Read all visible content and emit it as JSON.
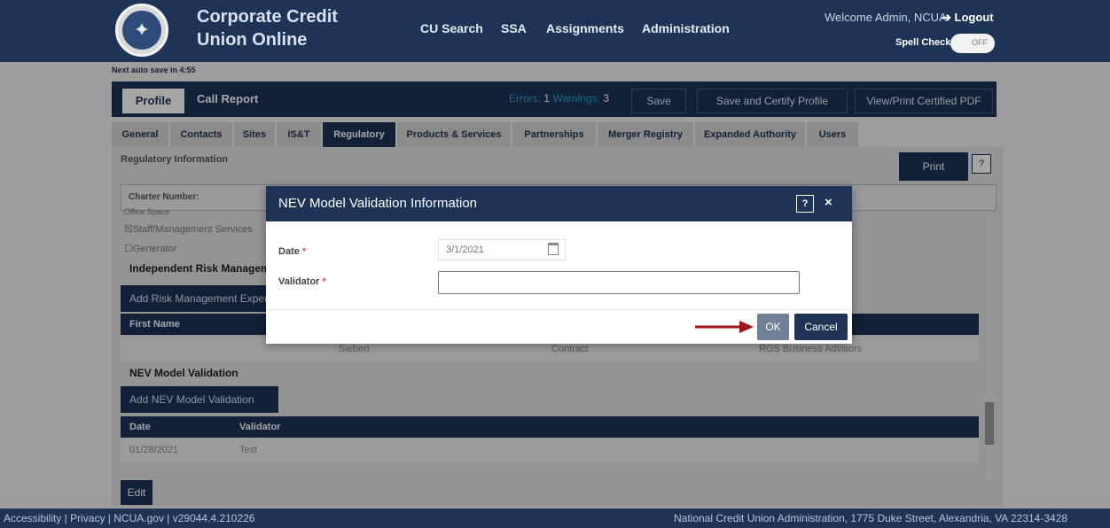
{
  "header": {
    "title_line1": "Corporate Credit",
    "title_line2": "Union Online",
    "nav": [
      "CU Search",
      "SSA",
      "Assignments",
      "Administration"
    ],
    "welcome": "Welcome Admin, NCUA",
    "logout": "Logout",
    "spell_check_label": "Spell Check",
    "spell_check_state": "OFF",
    "logo_glyph": "✦"
  },
  "autosave": "Next auto save in 4:55",
  "profile_bar": {
    "tabs": [
      "Profile",
      "Call Report"
    ],
    "errors_label": "Errors:",
    "errors_count": "1",
    "warnings_label": "Warnings:",
    "warnings_count": "3",
    "save": "Save",
    "save_certify": "Save and Certify Profile",
    "view_print": "View/Print Certified PDF"
  },
  "sub_tabs": [
    "General",
    "Contacts",
    "Sites",
    "IS&T",
    "Regulatory",
    "Products & Services",
    "Partnerships",
    "Merger Registry",
    "Expanded Authority",
    "Users"
  ],
  "active_sub_tab": "Regulatory",
  "content": {
    "section_title": "Regulatory Information",
    "print": "Print",
    "help": "?",
    "charter_label": "Charter Number:",
    "list_items": [
      "Office Space",
      "Staff/Management Services",
      "Generator"
    ],
    "risk_heading": "Independent Risk Management",
    "risk_button": "Add Risk Management Expert",
    "risk_table_header": "First Name",
    "risk_row": {
      "last": "Siebert",
      "type": "Contract",
      "company": "RGS Business Advisors"
    },
    "nev_heading": "NEV Model Validation",
    "nev_button": "Add NEV Model Validation",
    "nev_columns": [
      "Date",
      "Validator"
    ],
    "nev_rows": [
      {
        "date": "01/28/2021",
        "validator": "Test"
      }
    ],
    "edit": "Edit"
  },
  "modal": {
    "title": "NEV Model Validation Information",
    "help": "?",
    "close": "×",
    "date_label": "Date",
    "date_value": "3/1/2021",
    "validator_label": "Validator",
    "validator_value": "",
    "required_mark": "*",
    "ok": "OK",
    "cancel": "Cancel"
  },
  "footer": {
    "left": "Accessibility | Privacy | NCUA.gov | v29044.4.210226",
    "right": "National Credit Union Administration, 1775 Duke Street, Alexandria, VA 22314-3428"
  },
  "colors": {
    "navy": "#1d3456",
    "accent_cyan": "#23a6c9",
    "arrow_red": "#a3151b"
  }
}
